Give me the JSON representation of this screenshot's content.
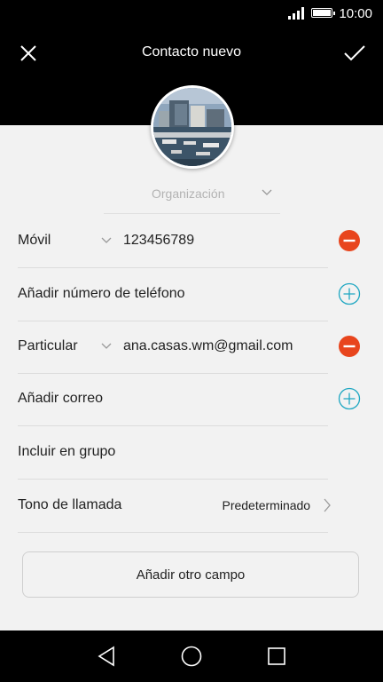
{
  "status": {
    "time": "10:00"
  },
  "header": {
    "title": "Contacto nuevo"
  },
  "organization": {
    "placeholder": "Organización"
  },
  "phone": {
    "label": "Móvil",
    "value": "123456789"
  },
  "add_phone": {
    "label": "Añadir número de teléfono"
  },
  "email": {
    "label": "Particular",
    "value": "ana.casas.wm@gmail.com"
  },
  "add_email": {
    "label": "Añadir correo"
  },
  "group": {
    "label": "Incluir en grupo"
  },
  "ringtone": {
    "label": "Tono de llamada",
    "value": "Predeterminado"
  },
  "add_field": {
    "label": "Añadir otro campo"
  },
  "colors": {
    "remove": "#e8451d",
    "add": "#1fa7c2",
    "header": "#000000"
  },
  "icons": [
    "close-icon",
    "check-icon",
    "remove-icon",
    "add-icon",
    "chevron-right-icon",
    "back-icon",
    "home-icon",
    "recent-icon"
  ]
}
